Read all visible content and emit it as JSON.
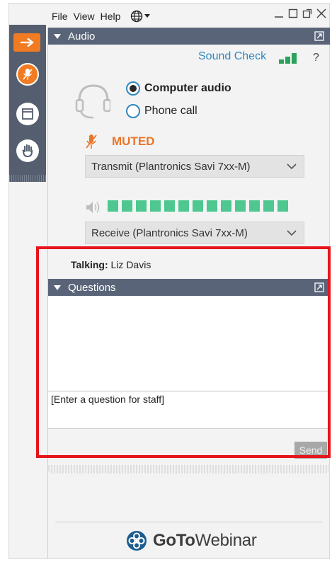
{
  "menu": {
    "file": "File",
    "view": "View",
    "help": "Help"
  },
  "audio": {
    "header": "Audio",
    "sound_check": "Sound Check",
    "help": "?",
    "options": [
      {
        "label": "Computer audio",
        "selected": true
      },
      {
        "label": "Phone call",
        "selected": false
      }
    ],
    "status": "MUTED",
    "transmit_device": "Transmit (Plantronics Savi 7xx-M)",
    "receive_device": "Receive (Plantronics Savi 7xx-M)",
    "signal_bars": 3,
    "speaker_level_segments": 13
  },
  "talking": {
    "label": "Talking:",
    "name": "Liz Davis"
  },
  "questions": {
    "header": "Questions",
    "placeholder": "[Enter a question for staff]",
    "send": "Send"
  },
  "logo": {
    "bold": "GoTo",
    "rest": "Webinar"
  },
  "colors": {
    "accent": "#f07b22",
    "header": "#5a6478",
    "link": "#2f88c0",
    "meter": "#4ec790",
    "highlight": "#e6141b",
    "muted": "#e8762b"
  }
}
